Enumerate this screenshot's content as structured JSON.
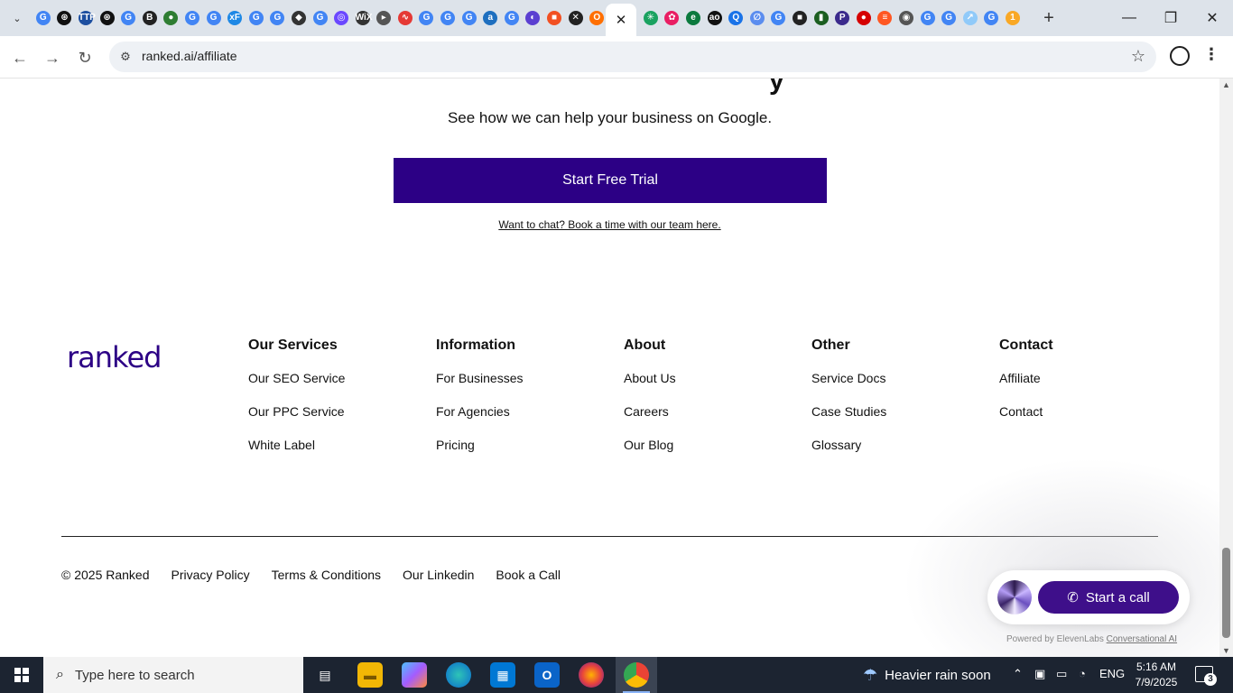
{
  "browser": {
    "url": "ranked.ai/affiliate",
    "tab_favicons": [
      "G",
      "⊛",
      "TTP",
      "⊛",
      "G",
      "B",
      "●",
      "G",
      "G",
      "xF",
      "G",
      "G",
      "◆",
      "G",
      "◎",
      "WiX",
      "▸",
      "∿",
      "G",
      "G",
      "G",
      "a",
      "G",
      "◐",
      "■",
      "✕",
      "O",
      "✳",
      "✿",
      "e",
      "ao",
      "Q",
      "∅",
      "G",
      "■",
      "▮",
      "P",
      "●",
      "≡",
      "◉",
      "G",
      "G",
      "↗",
      "G",
      "1"
    ],
    "tab_colors": [
      "#4285f4",
      "#111111",
      "#1d4fa0",
      "#111111",
      "#4285f4",
      "#222222",
      "#2e7d32",
      "#4285f4",
      "#4285f4",
      "#1e88e5",
      "#4285f4",
      "#4285f4",
      "#333333",
      "#4285f4",
      "#6b48ff",
      "#333333",
      "#555555",
      "#e53935",
      "#4285f4",
      "#4285f4",
      "#4285f4",
      "#1e6fbf",
      "#4285f4",
      "#5b3fd1",
      "#f25022",
      "#222222",
      "#ff6f00",
      "#1aa260",
      "#e91e63",
      "#0b7a3e",
      "#111111",
      "#1a73e8",
      "#5b8def",
      "#4285f4",
      "#222222",
      "#1b5e20",
      "#3b2a8c",
      "#d50000",
      "#ff5722",
      "#555555",
      "#4285f4",
      "#4285f4",
      "#90caf9",
      "#4285f4",
      "#f9a825"
    ],
    "active_tab_close": "✕",
    "new_tab": "+",
    "window_controls": {
      "minimize": "—",
      "restore": "❐",
      "close": "✕"
    }
  },
  "page": {
    "subtitle": "See how we can help your business on Google.",
    "cta_label": "Start Free Trial",
    "chat_link": "Want to chat? Book a time with our team here.",
    "logo": "ranked",
    "footer_columns": [
      {
        "title": "Our Services",
        "links": [
          "Our SEO Service",
          "Our PPC Service",
          "White Label"
        ]
      },
      {
        "title": "Information",
        "links": [
          "For Businesses",
          "For Agencies",
          "Pricing"
        ]
      },
      {
        "title": "About",
        "links": [
          "About Us",
          "Careers",
          "Our Blog"
        ]
      },
      {
        "title": "Other",
        "links": [
          "Service Docs",
          "Case Studies",
          "Glossary"
        ]
      },
      {
        "title": "Contact",
        "links": [
          "Affiliate",
          "Contact"
        ]
      }
    ],
    "bottom_links": [
      "© 2025 Ranked",
      "Privacy Policy",
      "Terms & Conditions",
      "Our Linkedin",
      "Book a Call"
    ],
    "call_widget": {
      "button_label": "Start a call",
      "powered_by": "Powered by ElevenLabs",
      "powered_link": "Conversational AI"
    },
    "brand_color": "#2c0085"
  },
  "taskbar": {
    "search_placeholder": "Type here to search",
    "weather": "Heavier rain soon",
    "language": "ENG",
    "time": "5:16 AM",
    "date": "7/9/2025",
    "notifications": "3"
  }
}
